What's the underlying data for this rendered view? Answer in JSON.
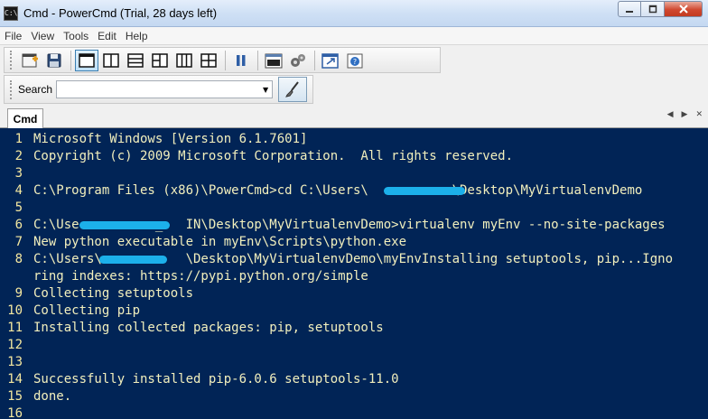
{
  "window": {
    "title": "Cmd - PowerCmd (Trial, 28 days left)",
    "app_icon_text": "C:\\"
  },
  "menu": [
    "File",
    "View",
    "Tools",
    "Edit",
    "Help"
  ],
  "search": {
    "label": "Search",
    "value": ""
  },
  "tabs": [
    {
      "label": "Cmd"
    }
  ],
  "console": {
    "lines": [
      {
        "n": "1",
        "text": "Microsoft Windows [Version 6.1.7601]"
      },
      {
        "n": "2",
        "text": "Copyright (c) 2009 Microsoft Corporation.  All rights reserved."
      },
      {
        "n": "3",
        "text": ""
      },
      {
        "n": "4",
        "text": "C:\\Program Files (x86)\\PowerCmd>cd C:\\Users\\           \\Desktop\\MyVirtualenvDemo"
      },
      {
        "n": "5",
        "text": ""
      },
      {
        "n": "6",
        "text": "C:\\Use          _   IN\\Desktop\\MyVirtualenvDemo>virtualenv myEnv --no-site-packages"
      },
      {
        "n": "7",
        "text": "New python executable in myEnv\\Scripts\\python.exe"
      },
      {
        "n": "8",
        "text": "C:\\Users\\           \\Desktop\\MyVirtualenvDemo\\myEnvInstalling setuptools, pip...Igno"
      },
      {
        "n": "",
        "text": "ring indexes: https://pypi.python.org/simple"
      },
      {
        "n": "9",
        "text": "Collecting setuptools"
      },
      {
        "n": "10",
        "text": "Collecting pip"
      },
      {
        "n": "11",
        "text": "Installing collected packages: pip, setuptools"
      },
      {
        "n": "12",
        "text": ""
      },
      {
        "n": "13",
        "text": ""
      },
      {
        "n": "14",
        "text": "Successfully installed pip-6.0.6 setuptools-11.0"
      },
      {
        "n": "15",
        "text": "done."
      },
      {
        "n": "16",
        "text": ""
      }
    ]
  },
  "colors": {
    "console_bg": "#012456",
    "console_text": "#f2efbd",
    "line_numbers": "#f4e8a0",
    "redaction": "#1cb0ea"
  }
}
